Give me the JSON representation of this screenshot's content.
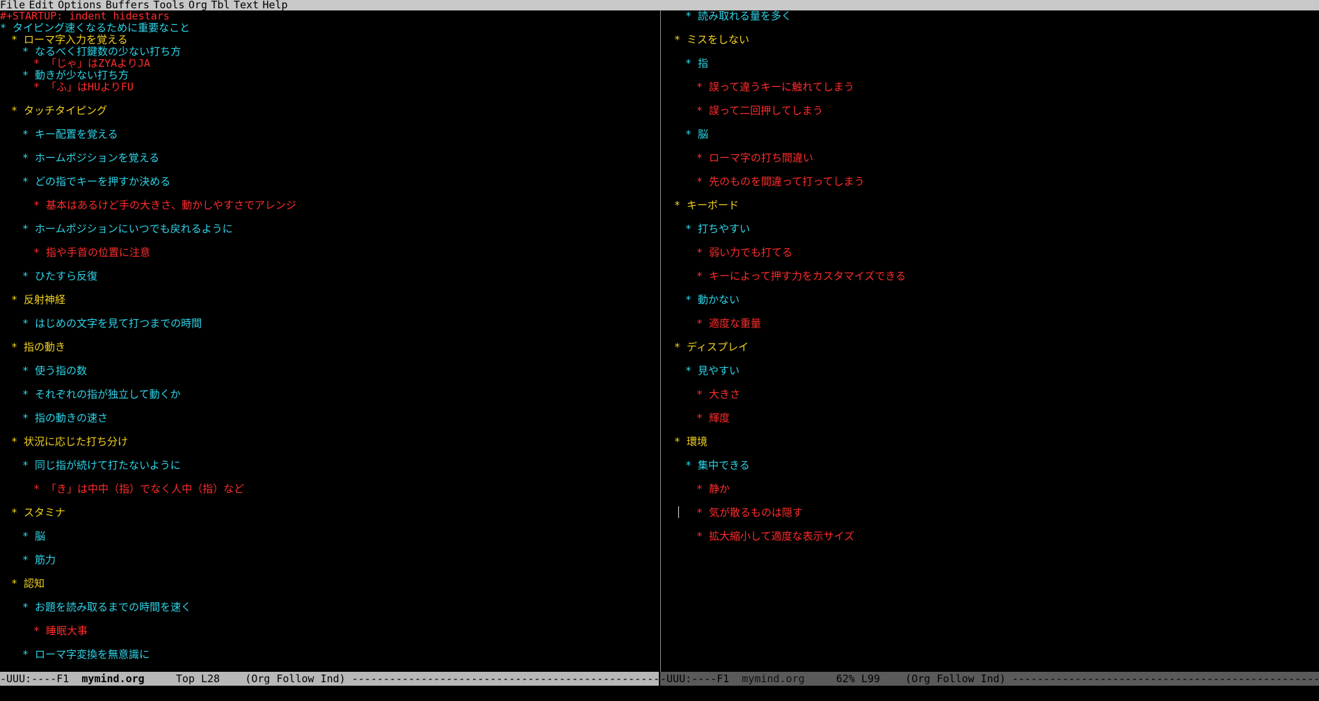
{
  "menubar": [
    "File",
    "Edit",
    "Options",
    "Buffers",
    "Tools",
    "Org",
    "Tbl",
    "Text",
    "Help"
  ],
  "left_pane": {
    "lines": [
      {
        "text": "#+STARTUP: indent hidestars",
        "cls": "c-startup",
        "indent": 0
      },
      {
        "text": "* タイピング速くなるために重要なこと",
        "cls": "c-l1",
        "indent": 0
      },
      {
        "text": "* ローマ字入力を覚える",
        "cls": "c-l2",
        "indent": 1
      },
      {
        "text": "* なるべく打鍵数の少ない打ち方",
        "cls": "c-l3",
        "indent": 2
      },
      {
        "text": "* 「じゃ」はZYAよりJA",
        "cls": "c-l4",
        "indent": 3
      },
      {
        "text": "* 動きが少ない打ち方",
        "cls": "c-l3",
        "indent": 2
      },
      {
        "text": "* 「ふ」はHUよりFU",
        "cls": "c-l4",
        "indent": 3
      },
      {
        "text": "* タッチタイピング",
        "cls": "c-l2",
        "indent": 1
      },
      {
        "text": "* キー配置を覚える",
        "cls": "c-l3",
        "indent": 2
      },
      {
        "text": "* ホームポジションを覚える",
        "cls": "c-l3",
        "indent": 2
      },
      {
        "text": "* どの指でキーを押すか決める",
        "cls": "c-l3",
        "indent": 2
      },
      {
        "text": "* 基本はあるけど手の大きさ、動かしやすさでアレンジ",
        "cls": "c-l4",
        "indent": 3
      },
      {
        "text": "* ホームポジションにいつでも戻れるように",
        "cls": "c-l3",
        "indent": 2
      },
      {
        "text": "* 指や手首の位置に注意",
        "cls": "c-l4",
        "indent": 3
      },
      {
        "text": "* ひたすら反復",
        "cls": "c-l3",
        "indent": 2
      },
      {
        "text": "* 反射神経",
        "cls": "c-l2",
        "indent": 1
      },
      {
        "text": "* はじめの文字を見て打つまでの時間",
        "cls": "c-l3",
        "indent": 2
      },
      {
        "text": "* 指の動き",
        "cls": "c-l2",
        "indent": 1
      },
      {
        "text": "* 使う指の数",
        "cls": "c-l3",
        "indent": 2
      },
      {
        "text": "* それぞれの指が独立して動くか",
        "cls": "c-l3",
        "indent": 2
      },
      {
        "text": "* 指の動きの速さ",
        "cls": "c-l3",
        "indent": 2
      },
      {
        "text": "* 状況に応じた打ち分け",
        "cls": "c-l2",
        "indent": 1
      },
      {
        "text": "* 同じ指が続けて打たないように",
        "cls": "c-l3",
        "indent": 2
      },
      {
        "text": "* 「き」は中中（指）でなく人中（指）など",
        "cls": "c-l4",
        "indent": 3
      },
      {
        "text": "* スタミナ",
        "cls": "c-l2",
        "indent": 1
      },
      {
        "text": "* 脳",
        "cls": "c-l3",
        "indent": 2
      },
      {
        "text": "* 筋力",
        "cls": "c-l3",
        "indent": 2
      },
      {
        "text": "* 認知",
        "cls": "c-l2",
        "indent": 1
      },
      {
        "text": "* お題を読み取るまでの時間を速く",
        "cls": "c-l3",
        "indent": 2
      },
      {
        "text": "* 睡眠大事",
        "cls": "c-l4",
        "indent": 3
      },
      {
        "text": "* ローマ字変換を無意識に",
        "cls": "c-l3",
        "indent": 2
      }
    ]
  },
  "right_pane": {
    "lines": [
      {
        "text": "* 読み取れる量を多く",
        "cls": "c-l3",
        "indent": 2
      },
      {
        "text": "* ミスをしない",
        "cls": "c-l2",
        "indent": 1
      },
      {
        "text": "* 指",
        "cls": "c-l3",
        "indent": 2
      },
      {
        "text": "* 誤って違うキーに触れてしまう",
        "cls": "c-l4",
        "indent": 3
      },
      {
        "text": "* 誤って二回押してしまう",
        "cls": "c-l4",
        "indent": 3
      },
      {
        "text": "* 脳",
        "cls": "c-l3",
        "indent": 2
      },
      {
        "text": "* ローマ字の打ち間違い",
        "cls": "c-l4",
        "indent": 3
      },
      {
        "text": "* 先のものを間違って打ってしまう",
        "cls": "c-l4",
        "indent": 3
      },
      {
        "text": "* キーボード",
        "cls": "c-l2",
        "indent": 1
      },
      {
        "text": "* 打ちやすい",
        "cls": "c-l3",
        "indent": 2
      },
      {
        "text": "* 弱い力でも打てる",
        "cls": "c-l4",
        "indent": 3
      },
      {
        "text": "* キーによって押す力をカスタマイズできる",
        "cls": "c-l4",
        "indent": 3
      },
      {
        "text": "* 動かない",
        "cls": "c-l3",
        "indent": 2
      },
      {
        "text": "* 適度な重量",
        "cls": "c-l4",
        "indent": 3
      },
      {
        "text": "* ディスプレイ",
        "cls": "c-l2",
        "indent": 1
      },
      {
        "text": "* 見やすい",
        "cls": "c-l3",
        "indent": 2
      },
      {
        "text": "* 大きさ",
        "cls": "c-l4",
        "indent": 3
      },
      {
        "text": "* 輝度",
        "cls": "c-l4",
        "indent": 3
      },
      {
        "text": "* 環境",
        "cls": "c-l2",
        "indent": 1
      },
      {
        "text": "* 集中できる",
        "cls": "c-l3",
        "indent": 2
      },
      {
        "text": "* 静か",
        "cls": "c-l4",
        "indent": 3
      },
      {
        "text": "* 気が散るものは隠す",
        "cls": "c-l4",
        "indent": 3
      },
      {
        "text": "* 拡大縮小して適度な表示サイズ",
        "cls": "c-l4",
        "indent": 3
      }
    ]
  },
  "modeline_left": {
    "status": "-UUU:----F1  ",
    "buffer": "mymind.org",
    "position": "     Top L28    ",
    "modes": "(Org Follow Ind) ",
    "fill": "----------------------------------------------------------------------------------------------------------------"
  },
  "modeline_right": {
    "status": "-UUU:----F1  ",
    "buffer": "mymind.org",
    "position": "     62% L99    ",
    "modes": "(Org Follow Ind) ",
    "fill": "----------------------------------------------------------------------------------------------------------------"
  },
  "colors": {
    "background": "#000000",
    "startup": "#ff2c2c",
    "level1": "#2dd4e8",
    "level2": "#f0d020",
    "level3": "#2dd4e8",
    "level4": "#ff2c2c",
    "menubar": "#c8c8c8",
    "modeline_active": "#b8b8b8",
    "modeline_inactive": "#5a5a5a"
  }
}
